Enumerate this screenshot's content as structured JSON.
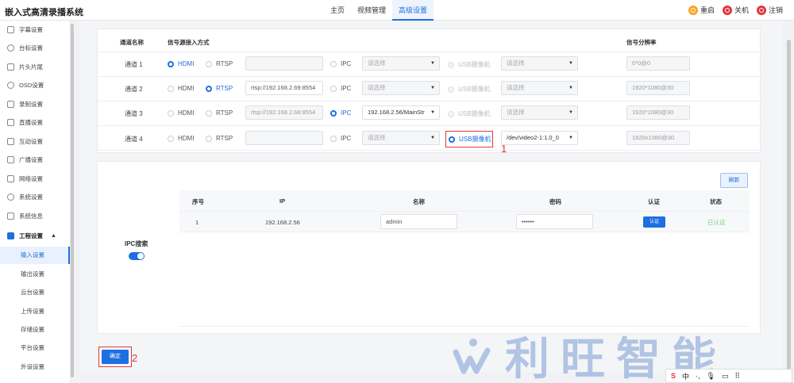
{
  "app": {
    "title": "嵌入式高清录播系统"
  },
  "nav": {
    "tabs": [
      "主页",
      "视频管理",
      "高级设置"
    ],
    "active": 2
  },
  "header_actions": [
    {
      "label": "重启",
      "icon": "restart-icon",
      "color": "#f5a623"
    },
    {
      "label": "关机",
      "icon": "power-icon",
      "color": "#e5343d"
    },
    {
      "label": "注销",
      "icon": "logout-icon",
      "color": "#e5343d"
    }
  ],
  "sidebar": {
    "items": [
      {
        "label": "字幕设置",
        "icon": "subtitle-icon"
      },
      {
        "label": "台标设置",
        "icon": "station-logo-icon"
      },
      {
        "label": "片头片尾",
        "icon": "film-icon"
      },
      {
        "label": "OSD设置",
        "icon": "osd-icon"
      },
      {
        "label": "录制设置",
        "icon": "record-icon"
      },
      {
        "label": "直播设置",
        "icon": "live-icon"
      },
      {
        "label": "互动设置",
        "icon": "interaction-icon"
      },
      {
        "label": "广播设置",
        "icon": "broadcast-icon"
      },
      {
        "label": "网络设置",
        "icon": "network-icon"
      },
      {
        "label": "系统设置",
        "icon": "system-settings-icon"
      },
      {
        "label": "系统信息",
        "icon": "system-info-icon"
      },
      {
        "label": "工程设置",
        "icon": "project-icon"
      }
    ],
    "sub_items": [
      "输入设置",
      "输出设置",
      "云台设置",
      "上传设置",
      "存储设置",
      "平台设置",
      "外设设置"
    ],
    "active_sub": 0
  },
  "channels": {
    "headers": {
      "name": "通道名称",
      "source": "信号源接入方式",
      "resolution": "信号分辨率"
    },
    "option_labels": {
      "hdmi": "HDMI",
      "rtsp": "RTSP",
      "ipc": "IPC",
      "usb": "USB摄像机"
    },
    "select_placeholder": "请选择",
    "rows": [
      {
        "name": "通道 1",
        "selected": "hdmi",
        "rtsp_url": "",
        "ipc_value": "请选择",
        "usb_value": "请选择",
        "resolution": "0*0@0"
      },
      {
        "name": "通道 2",
        "selected": "rtsp",
        "rtsp_url": "rtsp://192.168.2.69:8554",
        "ipc_value": "请选择",
        "usb_value": "请选择",
        "resolution": "1920*1080@30"
      },
      {
        "name": "通道 3",
        "selected": "ipc",
        "rtsp_url": "rtsp://192.168.2.68:8554",
        "ipc_value": "192.168.2.56/MainStr",
        "usb_value": "请选择",
        "resolution": "1920*1080@30"
      },
      {
        "name": "通道 4",
        "selected": "usb",
        "rtsp_url": "",
        "ipc_value": "请选择",
        "usb_value": "/dev/video2-1:1.0_0",
        "resolution": "1920x1080@30"
      }
    ]
  },
  "ipc": {
    "label": "IPC搜索",
    "toggle_on": true,
    "refresh_label": "刷新",
    "columns": [
      "序号",
      "IP",
      "名称",
      "密码",
      "认证",
      "状态"
    ],
    "rows": [
      {
        "index": "1",
        "ip": "192.168.2.56",
        "name": "admin",
        "password": "••••••",
        "auth_label": "认证",
        "status": "已认证"
      }
    ]
  },
  "confirm_label": "确定",
  "annotations": [
    "1",
    "2"
  ],
  "watermark": {
    "text": "利旺智能"
  },
  "ime": {
    "brand": "S",
    "label": "中",
    "extra": "·,"
  }
}
